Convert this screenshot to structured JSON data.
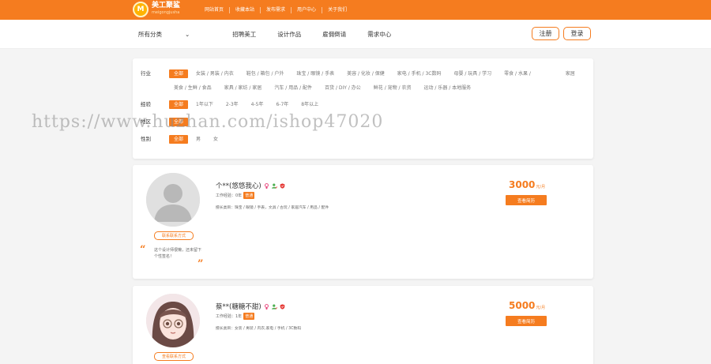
{
  "brand": {
    "title": "美工聚鲨",
    "subtitle": "meigongjusha"
  },
  "topnav": [
    "网站首页",
    "收藏本站",
    "发布需求",
    "用户中心",
    "关于我们"
  ],
  "mainnav": {
    "category": "所有分类",
    "items": [
      "招聘美工",
      "设计作品",
      "雇佣倒请",
      "需求中心"
    ]
  },
  "auth": {
    "register": "注册",
    "login": "登录"
  },
  "filters": [
    {
      "label": "行业",
      "options": [
        "全部",
        "女装 / 男装 / 内衣",
        "鞋包 / 箱包 / 户外",
        "珠宝 / 眼镜 / 手表",
        "美容 / 化妆 / 保健",
        "家电 / 手机 / 3C数码",
        "母婴 / 玩具 / 学习",
        "零食 / 水果 /",
        "家居",
        "美食 / 生鲜 / 食品",
        "家具 / 家纺 / 家居",
        "汽车 / 用品 / 配件",
        "百货 / DIY / 办公",
        "鲜花 / 宠物 / 农资",
        "运动 / 乐器 / 本地服务"
      ]
    },
    {
      "label": "经验",
      "options": [
        "全部",
        "1年以下",
        "2-3年",
        "4-5年",
        "6-7年",
        "8年以上"
      ]
    },
    {
      "label": "地区",
      "options": [
        "全部"
      ]
    },
    {
      "label": "性别",
      "options": [
        "全部",
        "男",
        "女"
      ]
    }
  ],
  "watermark": "https://www.huzhan.com/ishop47020",
  "designers": [
    {
      "name": "个**(悠悠我心)",
      "experience_label": "工作经验：0年",
      "level": "普通",
      "skills": "擅长类目：珠宝 / 眼镜 / 手表，文具 / 古玩 / 家居汽车 / 用品 / 配件",
      "contact_label": "联系联系方式",
      "quote": "这个设计师很懒，还未留下个性签名！",
      "price": "3000",
      "price_unit": "元/月",
      "view_label": "查看简历"
    },
    {
      "name": "蔡**(糖糖不甜)",
      "experience_label": "工作经验：1年",
      "level": "普通",
      "skills": "擅长类目：女装 / 男装 / 内衣,家电 / 手机 / 3C数码",
      "contact_label": "查看联系方式",
      "price": "5000",
      "price_unit": "元/月",
      "view_label": "查看简历"
    }
  ],
  "colors": {
    "accent": "#f57c1f",
    "female_icon": "#e8457c",
    "male_icon": "#4caf50",
    "verify_icon": "#e53935"
  }
}
